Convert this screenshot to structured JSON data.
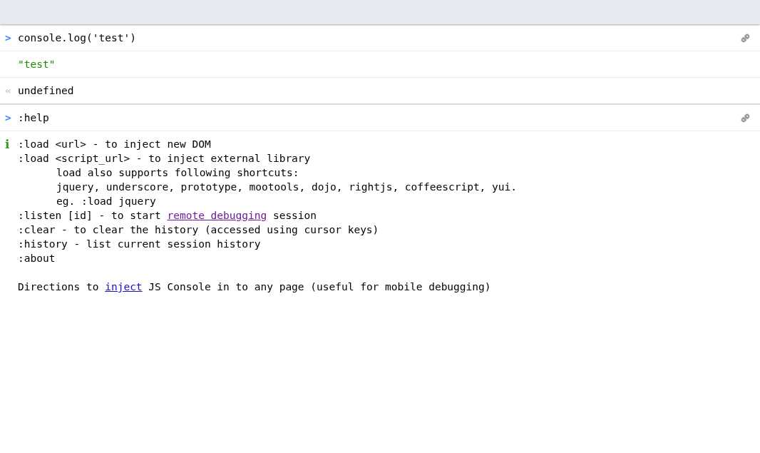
{
  "entries": [
    {
      "kind": "input",
      "prompt": ">",
      "text": "console.log('test')",
      "permalink": true
    },
    {
      "kind": "log",
      "text": "\"test\""
    },
    {
      "kind": "response",
      "prompt": "«",
      "text": "undefined"
    },
    {
      "kind": "input",
      "prompt": ">",
      "text": ":help",
      "permalink": true
    },
    {
      "kind": "info",
      "prompt": "i",
      "lines": [
        {
          "parts": [
            {
              "text": ":load <url> - to inject new DOM"
            }
          ]
        },
        {
          "parts": [
            {
              "text": ":load <script_url> - to inject external library"
            }
          ],
          "children": [
            {
              "parts": [
                {
                  "text": "load also supports following shortcuts:"
                }
              ]
            },
            {
              "parts": [
                {
                  "text": "jquery, underscore, prototype, mootools, dojo, rightjs, coffeescript, yui."
                }
              ]
            },
            {
              "parts": [
                {
                  "text": "eg. :load jquery"
                }
              ]
            }
          ]
        },
        {
          "parts": [
            {
              "text": ":listen [id] - to start "
            },
            {
              "text": "remote debugging",
              "link": true,
              "visited": true
            },
            {
              "text": " session"
            }
          ]
        },
        {
          "parts": [
            {
              "text": ":clear - to clear the history (accessed using cursor keys)"
            }
          ]
        },
        {
          "parts": [
            {
              "text": ":history - list current session history"
            }
          ]
        },
        {
          "parts": [
            {
              "text": ":about"
            }
          ]
        }
      ],
      "footer": [
        {
          "text": "Directions to "
        },
        {
          "text": "inject",
          "link": true,
          "visited": false
        },
        {
          "text": " JS Console in to any page (useful for mobile debugging)"
        }
      ]
    }
  ]
}
